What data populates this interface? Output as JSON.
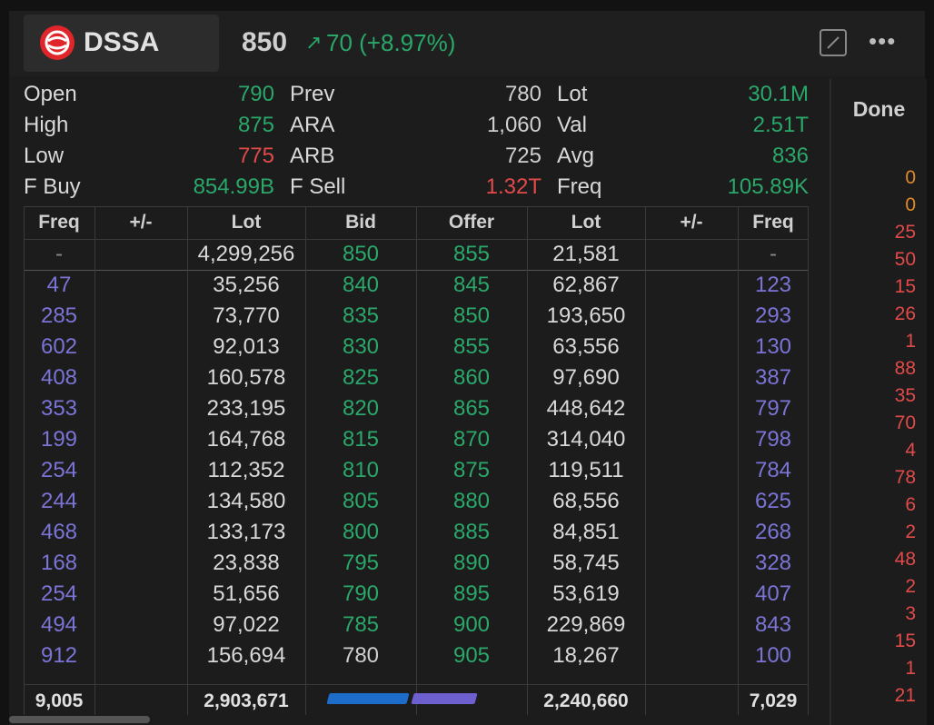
{
  "header": {
    "symbol": "DSSA",
    "price": "850",
    "arrow": "↗",
    "change": "70 (+8.97%)",
    "more": "•••"
  },
  "stats": [
    {
      "l1": "Open",
      "v1": "790",
      "c1": "g",
      "l2": "Prev",
      "v2": "780",
      "c2": "w",
      "l3": "Lot",
      "v3": "30.1M",
      "c3": "g"
    },
    {
      "l1": "High",
      "v1": "875",
      "c1": "g",
      "l2": "ARA",
      "v2": "1,060",
      "c2": "w",
      "l3": "Val",
      "v3": "2.51T",
      "c3": "g"
    },
    {
      "l1": "Low",
      "v1": "775",
      "c1": "r",
      "l2": "ARB",
      "v2": "725",
      "c2": "w",
      "l3": "Avg",
      "v3": "836",
      "c3": "g"
    },
    {
      "l1": "F Buy",
      "v1": "854.99B",
      "c1": "g",
      "l2": "F Sell",
      "v2": "1.32T",
      "c2": "r",
      "l3": "Freq",
      "v3": "105.89K",
      "c3": "g"
    }
  ],
  "columns": [
    "Freq",
    "+/-",
    "Lot",
    "Bid",
    "Offer",
    "Lot",
    "+/-",
    "Freq"
  ],
  "book_rows": [
    {
      "bf": "-",
      "bl": "4,299,256",
      "bid": "850",
      "offer": "855",
      "ol": "21,581",
      "of": "-",
      "bidc": "g",
      "offc": "g"
    },
    {
      "bf": "47",
      "bl": "35,256",
      "bid": "840",
      "offer": "845",
      "ol": "62,867",
      "of": "123",
      "bidc": "g",
      "offc": "g"
    },
    {
      "bf": "285",
      "bl": "73,770",
      "bid": "835",
      "offer": "850",
      "ol": "193,650",
      "of": "293",
      "bidc": "g",
      "offc": "g"
    },
    {
      "bf": "602",
      "bl": "92,013",
      "bid": "830",
      "offer": "855",
      "ol": "63,556",
      "of": "130",
      "bidc": "g",
      "offc": "g"
    },
    {
      "bf": "408",
      "bl": "160,578",
      "bid": "825",
      "offer": "860",
      "ol": "97,690",
      "of": "387",
      "bidc": "g",
      "offc": "g"
    },
    {
      "bf": "353",
      "bl": "233,195",
      "bid": "820",
      "offer": "865",
      "ol": "448,642",
      "of": "797",
      "bidc": "g",
      "offc": "g"
    },
    {
      "bf": "199",
      "bl": "164,768",
      "bid": "815",
      "offer": "870",
      "ol": "314,040",
      "of": "798",
      "bidc": "g",
      "offc": "g"
    },
    {
      "bf": "254",
      "bl": "112,352",
      "bid": "810",
      "offer": "875",
      "ol": "119,511",
      "of": "784",
      "bidc": "g",
      "offc": "g"
    },
    {
      "bf": "244",
      "bl": "134,580",
      "bid": "805",
      "offer": "880",
      "ol": "68,556",
      "of": "625",
      "bidc": "g",
      "offc": "g"
    },
    {
      "bf": "468",
      "bl": "133,173",
      "bid": "800",
      "offer": "885",
      "ol": "84,851",
      "of": "268",
      "bidc": "g",
      "offc": "g"
    },
    {
      "bf": "168",
      "bl": "23,838",
      "bid": "795",
      "offer": "890",
      "ol": "58,745",
      "of": "328",
      "bidc": "g",
      "offc": "g"
    },
    {
      "bf": "254",
      "bl": "51,656",
      "bid": "790",
      "offer": "895",
      "ol": "53,619",
      "of": "407",
      "bidc": "g",
      "offc": "g"
    },
    {
      "bf": "494",
      "bl": "97,022",
      "bid": "785",
      "offer": "900",
      "ol": "229,869",
      "of": "843",
      "bidc": "g",
      "offc": "g"
    },
    {
      "bf": "912",
      "bl": "156,694",
      "bid": "780",
      "offer": "905",
      "ol": "18,267",
      "of": "100",
      "bidc": "w",
      "offc": "g"
    }
  ],
  "totals": {
    "bid_freq": "9,005",
    "bid_lot": "2,903,671",
    "offer_lot": "2,240,660",
    "offer_freq": "7,029"
  },
  "done": {
    "title": "Done",
    "values": [
      {
        "v": "0",
        "c": "o"
      },
      {
        "v": "0",
        "c": "o"
      },
      {
        "v": "25",
        "c": "r"
      },
      {
        "v": "50",
        "c": "r"
      },
      {
        "v": "15",
        "c": "r"
      },
      {
        "v": "26",
        "c": "r"
      },
      {
        "v": "1",
        "c": "r"
      },
      {
        "v": "88",
        "c": "r"
      },
      {
        "v": "35",
        "c": "r"
      },
      {
        "v": "70",
        "c": "r"
      },
      {
        "v": "4",
        "c": "r"
      },
      {
        "v": "78",
        "c": "r"
      },
      {
        "v": "6",
        "c": "r"
      },
      {
        "v": "2",
        "c": "r"
      },
      {
        "v": "48",
        "c": "r"
      },
      {
        "v": "2",
        "c": "r"
      },
      {
        "v": "3",
        "c": "r"
      },
      {
        "v": "15",
        "c": "r"
      },
      {
        "v": "1",
        "c": "r"
      },
      {
        "v": "21",
        "c": "r"
      }
    ]
  }
}
